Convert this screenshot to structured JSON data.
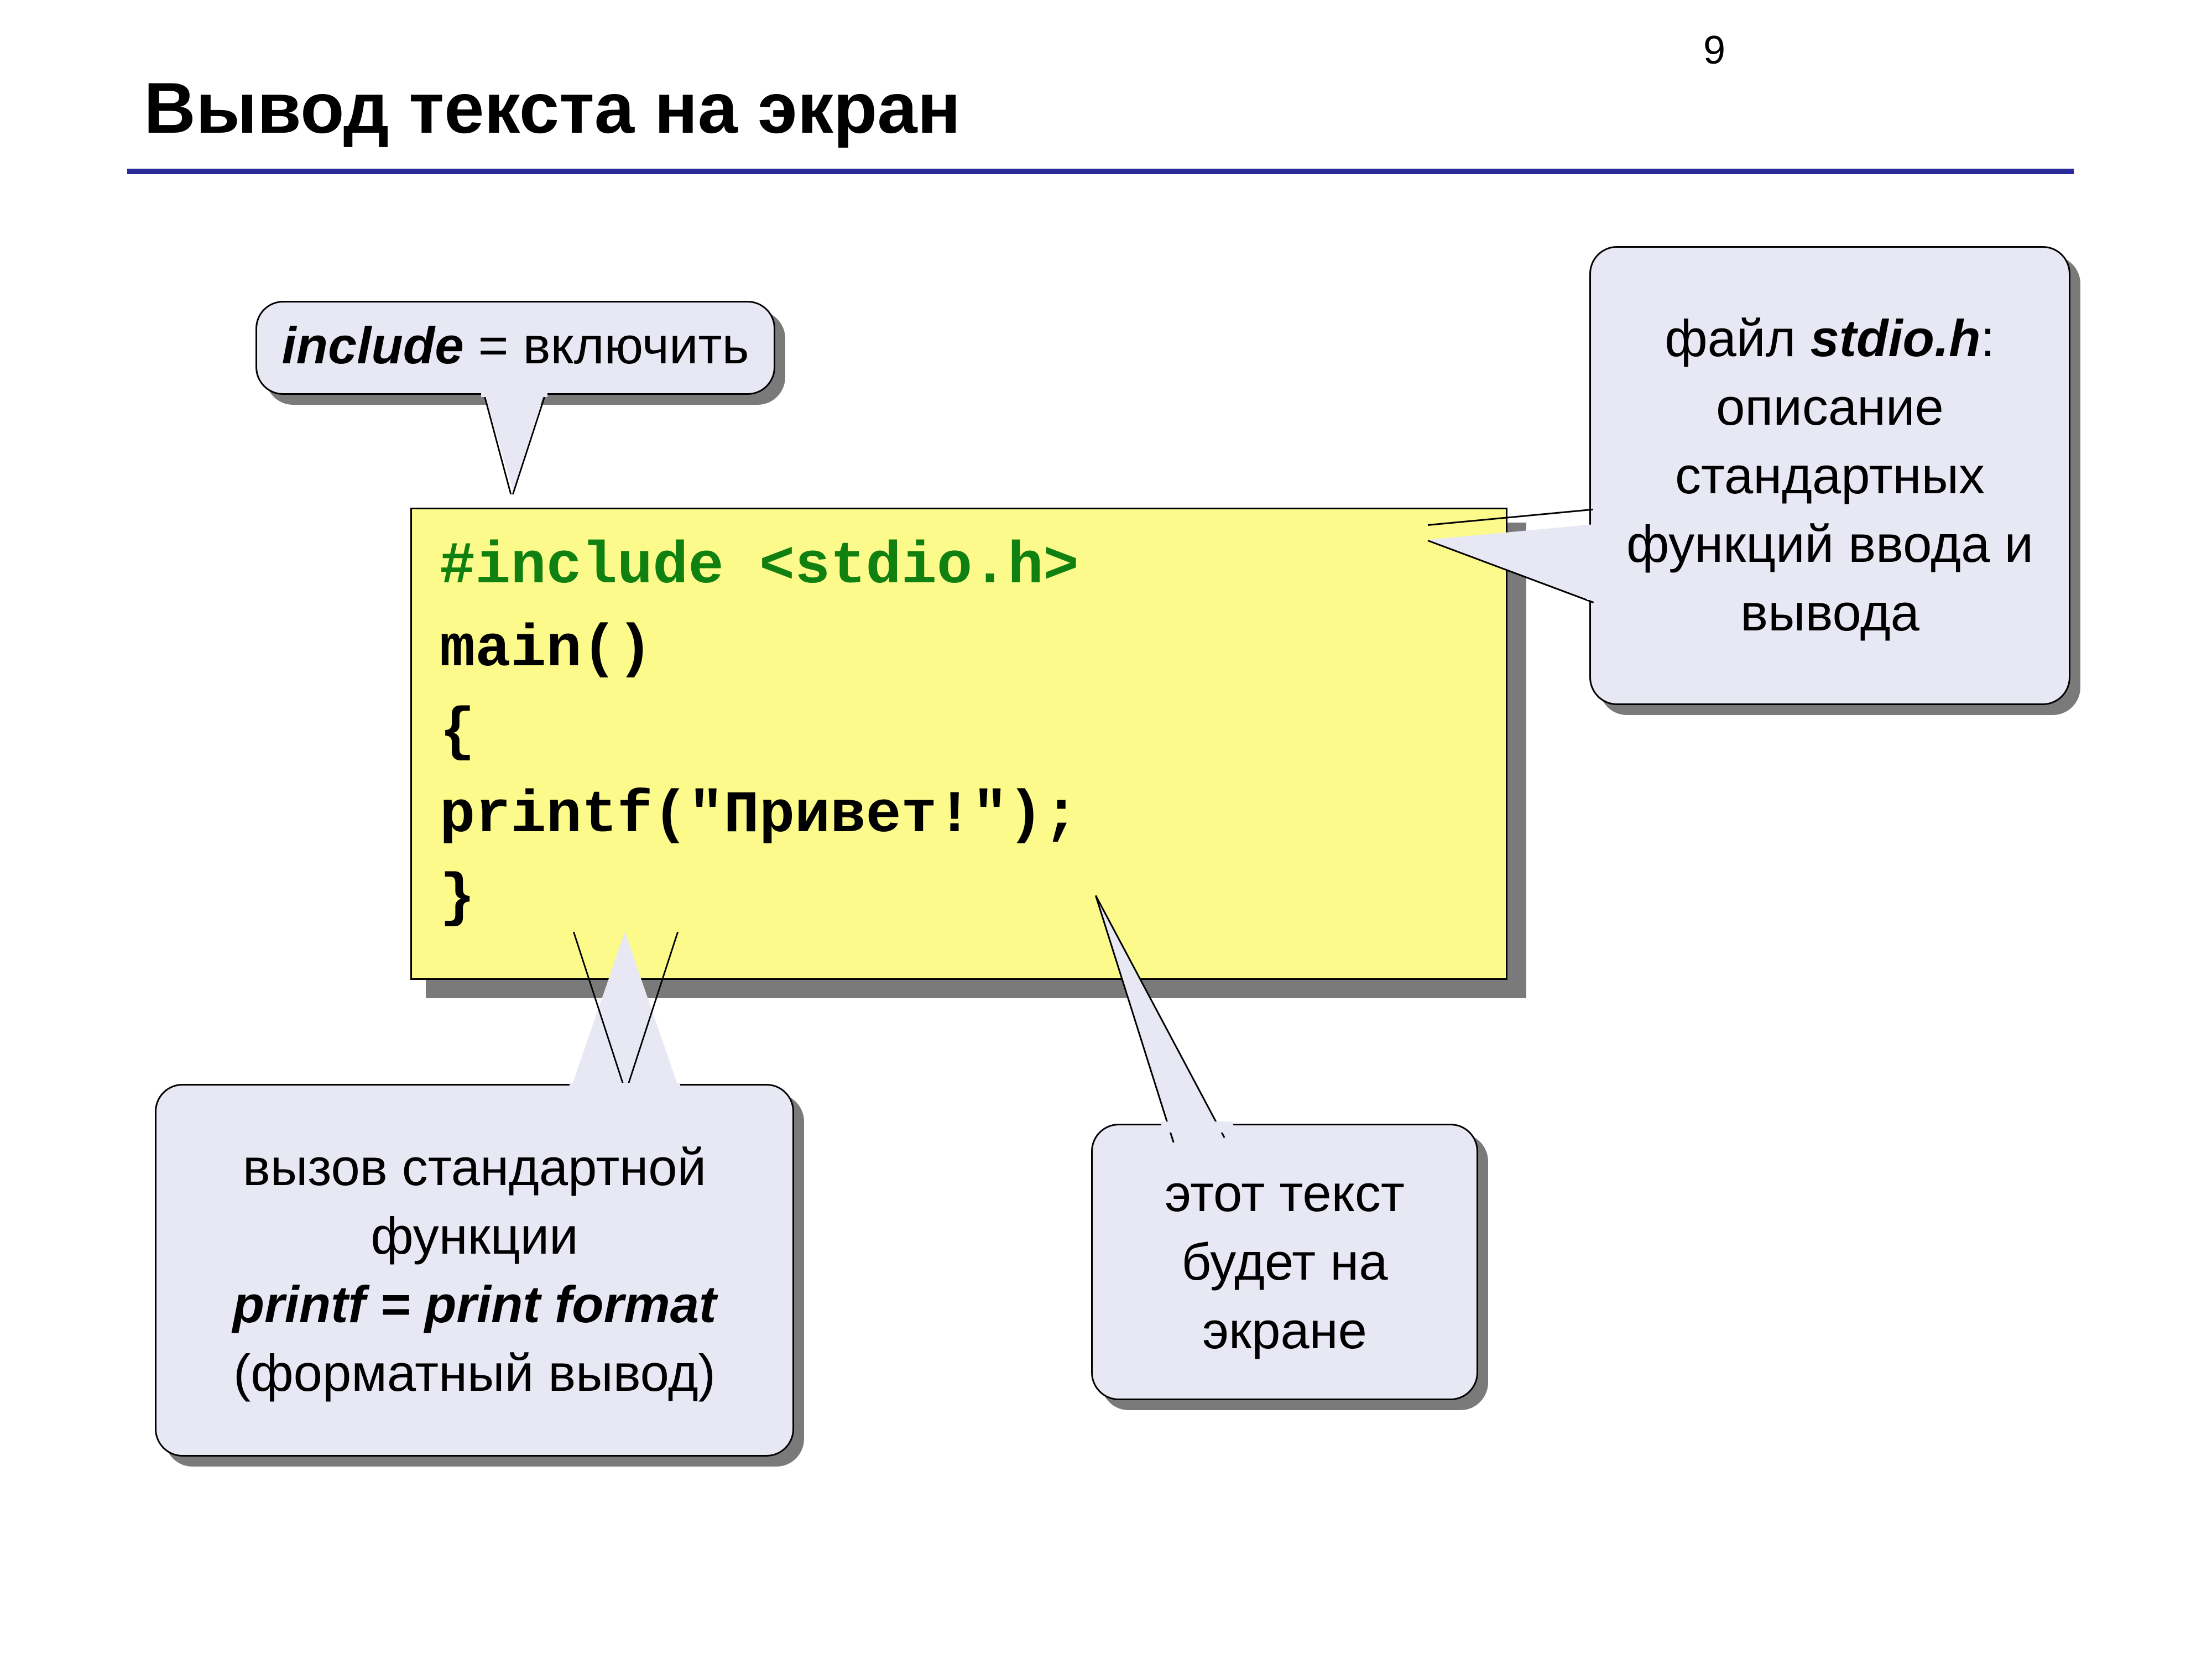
{
  "page_number": "9",
  "title": "Вывод текста на экран",
  "code": {
    "include_line": "#include <stdio.h>",
    "main_line": "main()",
    "open_brace": "{",
    "printf_line": "printf(\"Привет!\");",
    "close_brace": "}"
  },
  "callouts": {
    "include": {
      "em": "include",
      "rest": " = включить"
    },
    "stdio": {
      "prefix": "файл ",
      "em": "stdio.h",
      "rest": ": описание стандартных функций ввода и вывода"
    },
    "printf": {
      "line1": "вызов стандартной функции",
      "em": "printf = print format",
      "line3": "(форматный вывод)"
    },
    "screen": {
      "text": "этот текст будет на экране"
    }
  }
}
